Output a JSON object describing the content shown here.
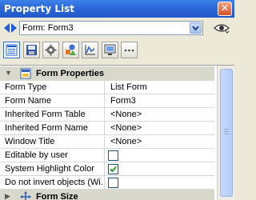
{
  "window": {
    "title": "Property List",
    "close_glyph": "✕"
  },
  "selector": {
    "value": "Form: Form3",
    "nav_icon": "back-forward-arrows-icon",
    "dropdown_icon": "chevron-down-icon",
    "eye_icon": "eye-icon"
  },
  "toolbar": {
    "buttons": [
      {
        "icon": "property-list-icon",
        "active": true
      },
      {
        "icon": "floppy-disk-icon"
      },
      {
        "icon": "gear-icon"
      },
      {
        "icon": "shapes-icon"
      },
      {
        "icon": "line-chart-icon"
      },
      {
        "icon": "monitor-icon"
      },
      {
        "icon": "more-dots-icon"
      }
    ]
  },
  "sections": [
    {
      "label": "Form Properties",
      "expanded": true,
      "rows": [
        {
          "name": "Form Type",
          "value": "List Form"
        },
        {
          "name": "Form Name",
          "value": "Form3"
        },
        {
          "name": "Inherited Form Table",
          "value": "<None>"
        },
        {
          "name": "Inherited Form Name",
          "value": "<None>"
        },
        {
          "name": "Window Title",
          "value": "<None>"
        },
        {
          "name": "Editable by user",
          "checked": false
        },
        {
          "name": "System Highlight Color",
          "checked": true
        },
        {
          "name": "Do not invert objects (Wi...",
          "checked": false
        }
      ]
    },
    {
      "label": "Form Size",
      "expanded": false
    }
  ],
  "colors": {
    "title_bar": "#2b67d8",
    "section_header": "#d9d8cd",
    "check_green": "#21a121"
  }
}
